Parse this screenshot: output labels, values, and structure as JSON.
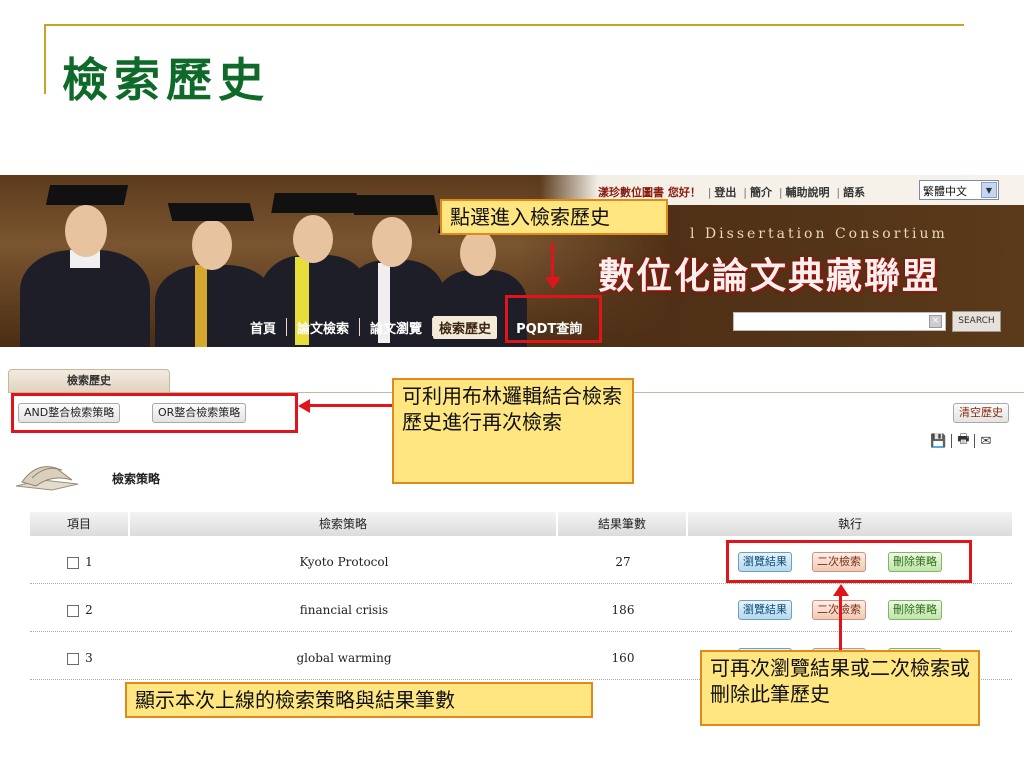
{
  "slide": {
    "title": "檢索歷史"
  },
  "banner": {
    "user_greeting": "漾珍數位圖書 您好！",
    "user_links": [
      "登出",
      "簡介",
      "輔助說明",
      "語系"
    ],
    "language_selected": "繁體中文",
    "consortium_en": "l Dissertation Consortium",
    "consortium_zh": "數位化論文典藏聯盟",
    "nav": [
      "首頁",
      "論文檢索",
      "論文瀏覽",
      "檢索歷史",
      "PQDT查詢"
    ],
    "search_button": "SEARCH"
  },
  "page": {
    "tab_label": "檢索歷史",
    "and_button": "AND整合檢索策略",
    "or_button": "OR整合檢索策略",
    "clear_history": "清空歷史",
    "section_title": "檢索策略"
  },
  "table": {
    "headers": [
      "項目",
      "檢索策略",
      "結果筆數",
      "執行"
    ],
    "rows": [
      {
        "index": "1",
        "strategy": "Kyoto Protocol",
        "count": "27"
      },
      {
        "index": "2",
        "strategy": "financial crisis",
        "count": "186"
      },
      {
        "index": "3",
        "strategy": "global warming",
        "count": "160"
      }
    ],
    "actions": {
      "view": "瀏覽結果",
      "again": "二次檢索",
      "delete": "刪除策略"
    }
  },
  "annotations": {
    "enter_history": "點選進入檢索歷史",
    "boolean_note": "可利用布林邏輯結合檢索歷史進行再次檢索",
    "row_note": "可再次瀏覽結果或二次檢索或刪除此筆歷史",
    "bottom_note": "顯示本次上線的檢索策略與結果筆數"
  },
  "colors": {
    "title_green": "#0f6a2a",
    "annotation_red": "#e0141b",
    "callout_fill": "#ffe680"
  }
}
